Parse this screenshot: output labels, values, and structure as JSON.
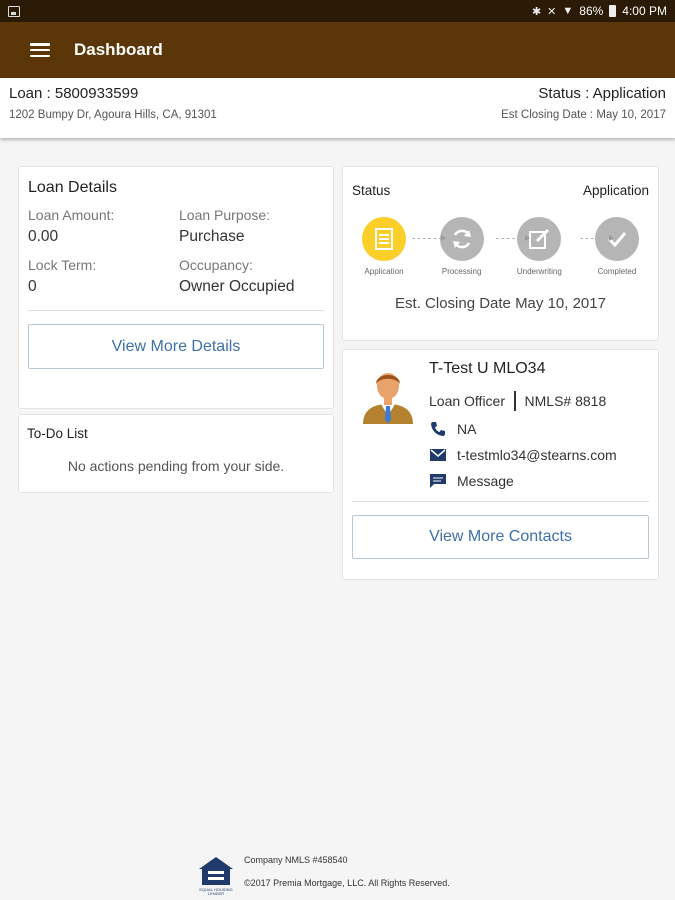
{
  "statusbar": {
    "battery": "86%",
    "time": "4:00 PM"
  },
  "appbar": {
    "title": "Dashboard"
  },
  "loan": {
    "number": "Loan : 5800933599",
    "status": "Status : Application",
    "address": "1202 Bumpy Dr, Agoura Hills, CA, 91301",
    "est_closing": "Est Closing Date : May 10, 2017"
  },
  "loan_details": {
    "title": "Loan Details",
    "fields": [
      {
        "label": "Loan Amount:",
        "value": "0.00"
      },
      {
        "label": "Loan Purpose:",
        "value": "Purchase"
      },
      {
        "label": "Lock Term:",
        "value": "0"
      },
      {
        "label": "Occupancy:",
        "value": "Owner Occupied"
      }
    ],
    "button": "View More Details"
  },
  "todo": {
    "title": "To-Do List",
    "message": "No actions pending from your side."
  },
  "status_card": {
    "title": "Status",
    "value": "Application",
    "steps": [
      "Application",
      "Processing",
      "Underwriting",
      "Completed"
    ],
    "active_step": 0,
    "est_date": "Est. Closing Date May 10, 2017",
    "colors": {
      "active": "#fcce2a",
      "inactive": "#b5b5b5"
    }
  },
  "contact": {
    "name": "T-Test U MLO34",
    "role": "Loan Officer",
    "nmls": "NMLS# 8818",
    "phone": "NA",
    "email": "t-testmlo34@stearns.com",
    "message": "Message",
    "button": "View More Contacts"
  },
  "footer": {
    "nmls": "Company NMLS #458540",
    "copyright": "©2017 Premia Mortgage, LLC. All Rights Reserved.",
    "logo_text": "EQUAL HOUSING LENDER"
  }
}
